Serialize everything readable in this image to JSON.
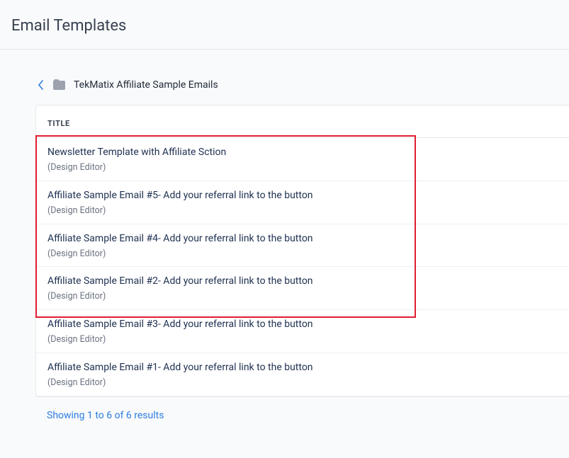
{
  "header": {
    "title": "Email Templates"
  },
  "breadcrumb": {
    "folder_name": "TekMatix Affiliate Sample Emails"
  },
  "table": {
    "column_label": "TITLE",
    "rows": [
      {
        "title": "Newsletter Template with Affiliate Sction",
        "sub": "(Design Editor)"
      },
      {
        "title": "Affiliate Sample Email #5- Add your referral link to the button",
        "sub": "(Design Editor)"
      },
      {
        "title": "Affiliate Sample Email #4- Add your referral link to the button",
        "sub": "(Design Editor)"
      },
      {
        "title": "Affiliate Sample Email #2- Add your referral link to the button",
        "sub": "(Design Editor)"
      },
      {
        "title": "Affiliate Sample Email #3- Add your referral link to the button",
        "sub": "(Design Editor)"
      },
      {
        "title": "Affiliate Sample Email #1- Add your referral link to the button",
        "sub": "(Design Editor)"
      }
    ]
  },
  "pagination": {
    "results_text": "Showing 1 to 6 of 6 results"
  },
  "annotation": {
    "highlight_color": "#e11d33"
  }
}
